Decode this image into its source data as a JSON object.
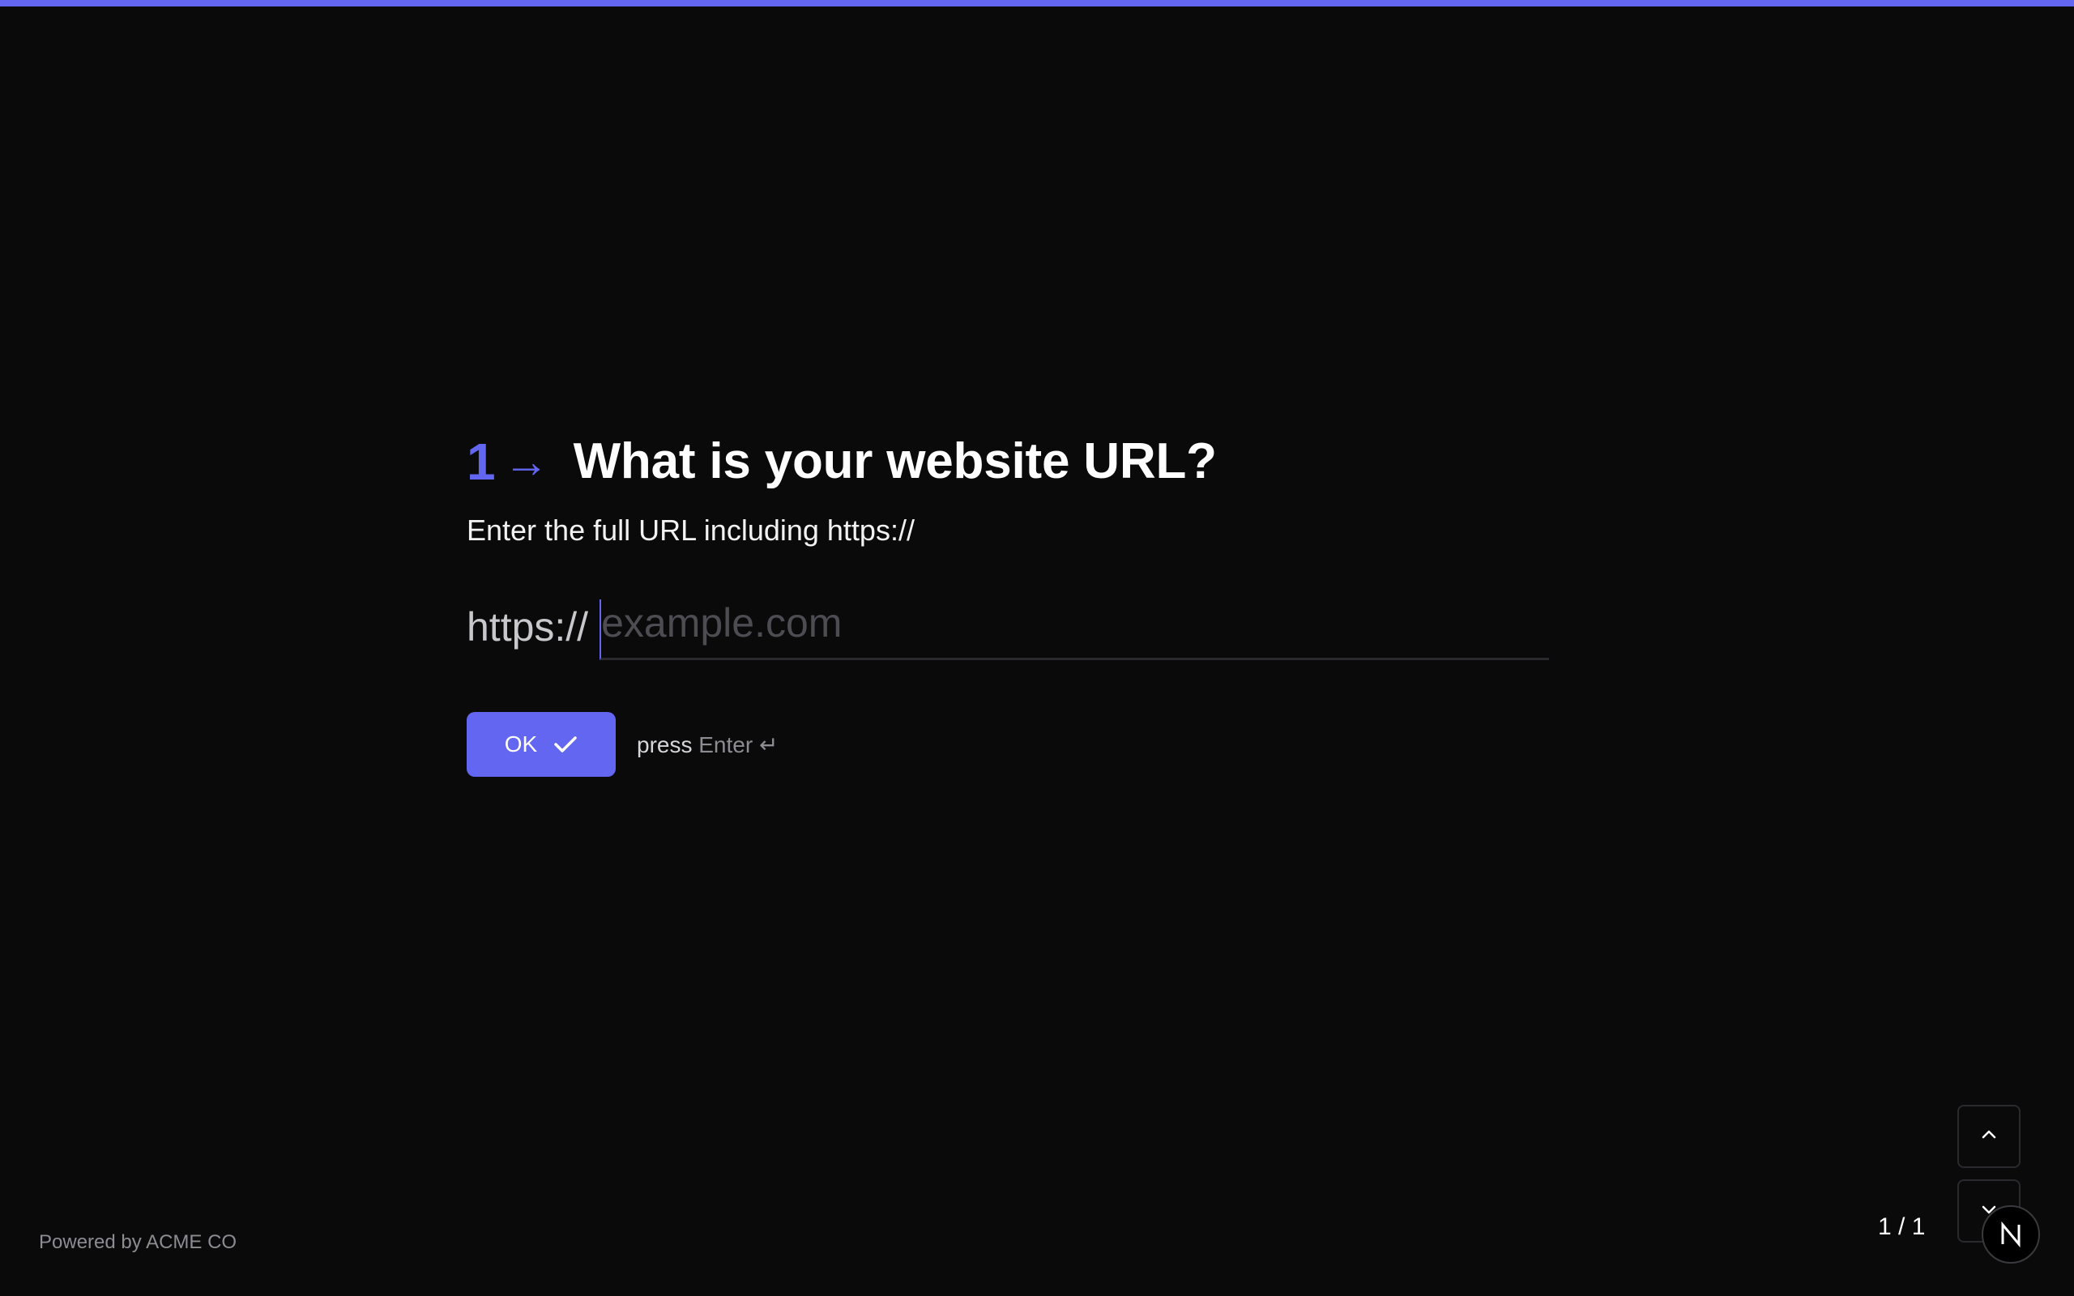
{
  "progress": {
    "fraction": 1.0,
    "color": "#6366f1"
  },
  "question": {
    "number": "1",
    "arrow": "→",
    "title": "What is your website URL?",
    "subtitle": "Enter the full URL including https://"
  },
  "url_field": {
    "prefix": "https://",
    "placeholder": "example.com",
    "value": ""
  },
  "actions": {
    "ok_label": "OK",
    "ok_icon": "check-icon",
    "hint_press": "press",
    "hint_key": "Enter ↵"
  },
  "footer": {
    "brand": "Powered by ACME CO"
  },
  "navigation": {
    "up_icon": "chevron-up-icon",
    "down_icon": "chevron-down-icon",
    "page_counter": "1 / 1"
  },
  "badge": {
    "letter": "N",
    "icon": "n-logo-icon"
  },
  "colors": {
    "accent": "#6366f1",
    "background": "#0a0a0b"
  }
}
